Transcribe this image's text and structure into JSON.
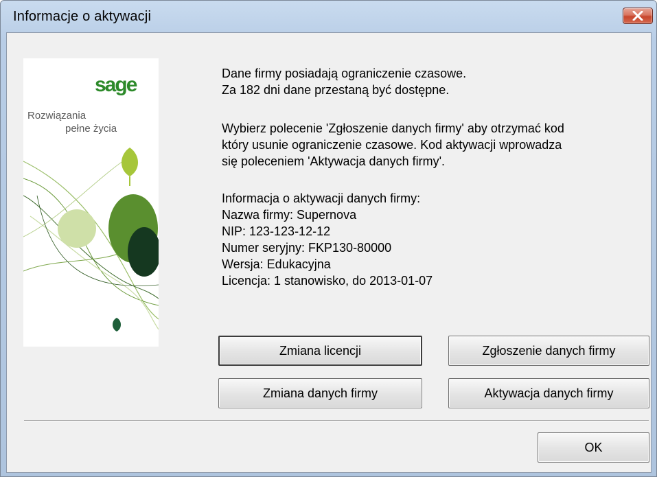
{
  "window": {
    "title": "Informacje o aktywacji"
  },
  "branding": {
    "logo_text": "sage",
    "slogan_line1": "Rozwiązania",
    "slogan_line2": "pełne życia"
  },
  "message": {
    "line1": "Dane firmy posiadają ograniczenie czasowe.",
    "line2": "Za 182 dni dane przestaną być dostępne.",
    "line3": "Wybierz polecenie 'Zgłoszenie danych firmy' aby otrzymać kod",
    "line4": "który usunie ograniczenie czasowe. Kod aktywacji wprowadza",
    "line5": "się poleceniem 'Aktywacja danych firmy'."
  },
  "info": {
    "header": "Informacja o aktywacji danych firmy:",
    "company": "Nazwa firmy: Supernova",
    "nip": "NIP: 123-123-12-12",
    "serial": "Numer seryjny: FKP130-80000",
    "version": "Wersja: Edukacyjna",
    "license": "Licencja: 1 stanowisko, do 2013-01-07"
  },
  "buttons": {
    "change_license": "Zmiana licencji",
    "report_company": "Zgłoszenie danych firmy",
    "change_company": "Zmiana danych firmy",
    "activate_company": "Aktywacja danych firmy",
    "ok": "OK"
  },
  "colors": {
    "brand_green": "#2d8a2a",
    "close_red": "#c8452c"
  }
}
